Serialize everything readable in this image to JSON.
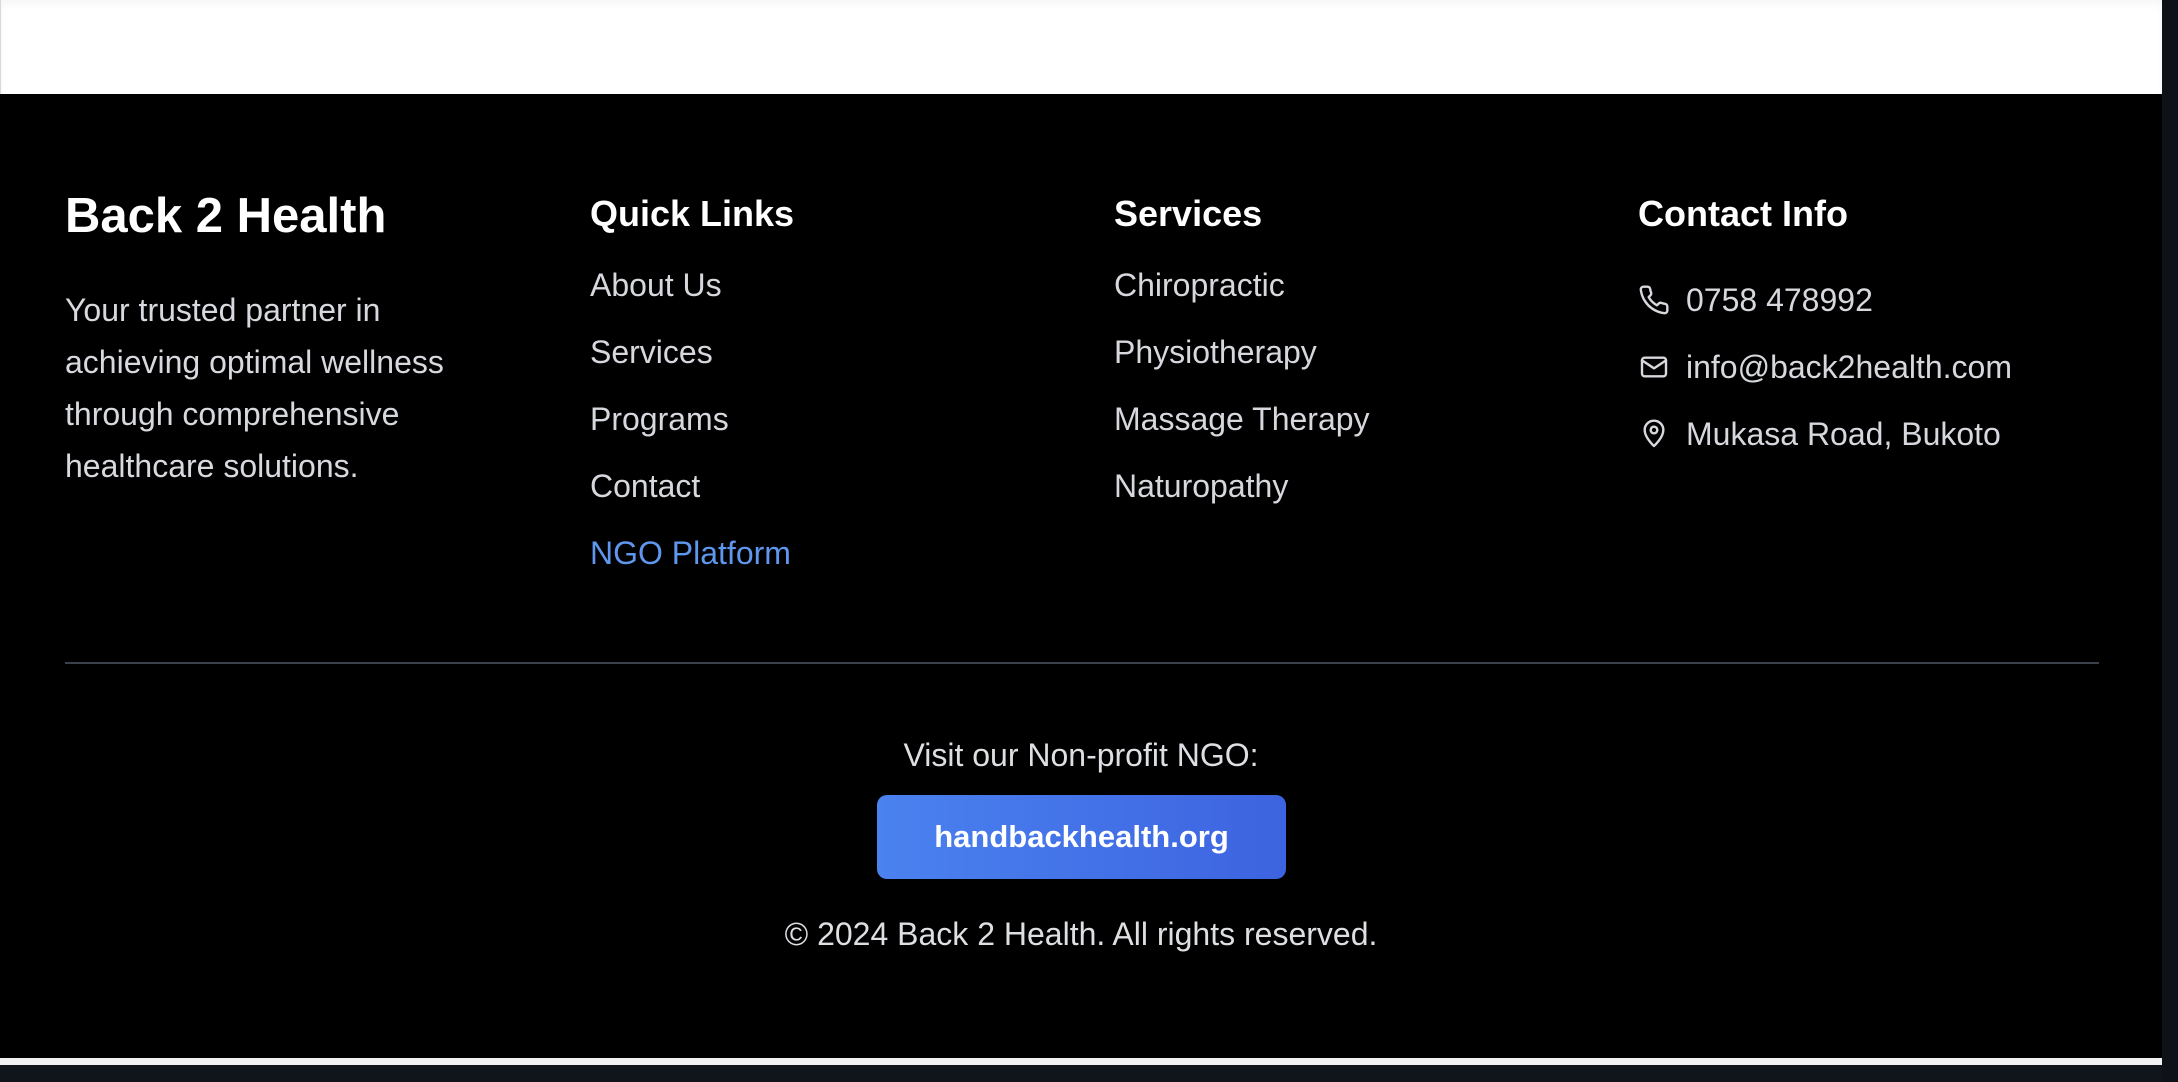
{
  "brand": {
    "title": "Back 2 Health",
    "description": "Your trusted partner in achieving optimal wellness through comprehensive healthcare solutions."
  },
  "quick_links": {
    "title": "Quick Links",
    "items": [
      {
        "label": "About Us"
      },
      {
        "label": "Services"
      },
      {
        "label": "Programs"
      },
      {
        "label": "Contact"
      },
      {
        "label": "NGO Platform"
      }
    ]
  },
  "services": {
    "title": "Services",
    "items": [
      {
        "label": "Chiropractic"
      },
      {
        "label": "Physiotherapy"
      },
      {
        "label": "Massage Therapy"
      },
      {
        "label": "Naturopathy"
      }
    ]
  },
  "contact": {
    "title": "Contact Info",
    "items": [
      {
        "icon": "phone-icon",
        "text": "0758 478992"
      },
      {
        "icon": "mail-icon",
        "text": "info@back2health.com"
      },
      {
        "icon": "location-pin-icon",
        "text": "Mukasa Road, Bukoto"
      }
    ]
  },
  "ngo": {
    "visit_text": "Visit our Non-profit NGO:",
    "button_label": "handbackhealth.org"
  },
  "copyright": "© 2024 Back 2 Health. All rights reserved.",
  "colors": {
    "footer_background": "#000000",
    "highlight_link": "#5f96ee",
    "button_gradient_start": "#4a82ef",
    "button_gradient_end": "#3d63e0"
  }
}
